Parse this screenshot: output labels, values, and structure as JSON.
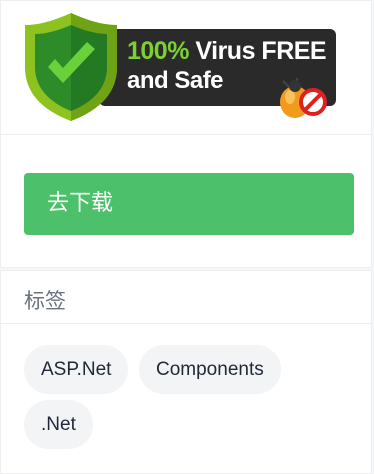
{
  "badge": {
    "percent": "100%",
    "line1_rest": " Virus FREE",
    "line2": "and Safe",
    "icons": [
      "shield-check-icon",
      "no-bug-icon"
    ],
    "colors": {
      "shield_outer": "#8dc21f",
      "shield_inner": "#2e8b2a",
      "check": "#6ad13a",
      "badge_bg": "#2a2a2a",
      "percent_green": "#7bd12f"
    }
  },
  "download": {
    "label": "去下载",
    "color": "#4cc06a"
  },
  "tags_section": {
    "title": "标签",
    "tags": [
      "ASP.Net",
      "Components",
      ".Net"
    ]
  }
}
